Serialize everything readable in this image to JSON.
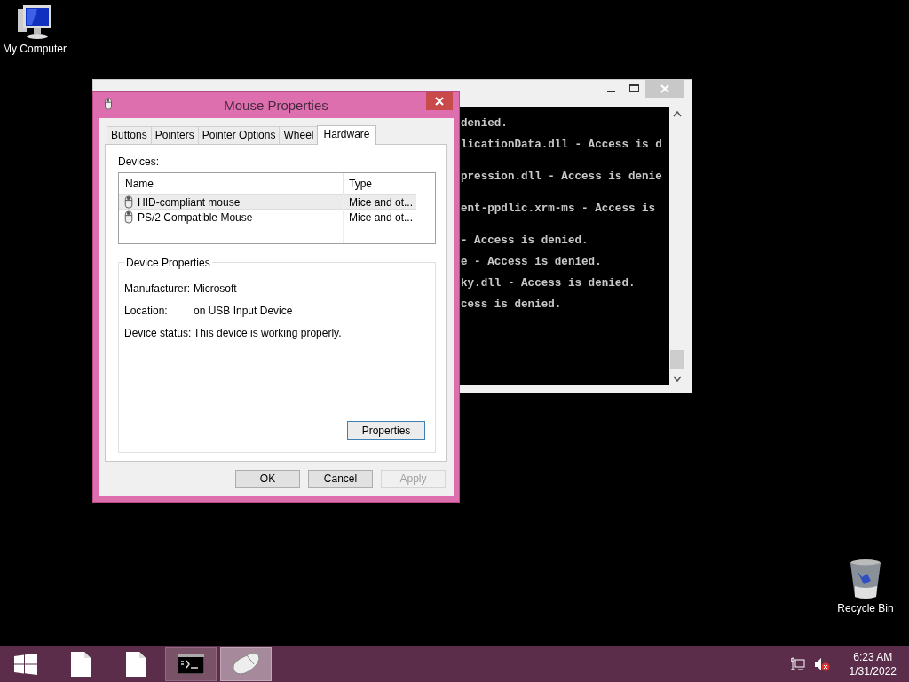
{
  "desktop_icons": [
    {
      "label": "My Computer",
      "kind": "computer"
    },
    {
      "label": "Recycle Bin",
      "kind": "bin"
    }
  ],
  "console_window": {
    "lines": [
      "denied.",
      "licationData.dll - Access is d",
      "pression.dll - Access is denie",
      "ent-ppdlic.xrm-ms - Access is",
      "- Access is denied.",
      "e - Access is denied.",
      "ky.dll - Access is denied.",
      "cess is denied."
    ]
  },
  "dialog": {
    "title": "Mouse Properties",
    "tabs": [
      {
        "label": "Buttons",
        "selected": false
      },
      {
        "label": "Pointers",
        "selected": false
      },
      {
        "label": "Pointer Options",
        "selected": false
      },
      {
        "label": "Wheel",
        "selected": false
      },
      {
        "label": "Hardware",
        "selected": true
      }
    ],
    "devices_label": "Devices:",
    "columns": [
      "Name",
      "Type"
    ],
    "devices": [
      {
        "name": "HID-compliant mouse",
        "type": "Mice and ot...",
        "selected": true
      },
      {
        "name": "PS/2 Compatible Mouse",
        "type": "Mice and ot...",
        "selected": false
      }
    ],
    "group_title": "Device Properties",
    "properties": [
      {
        "label": "Manufacturer:",
        "value": "Microsoft"
      },
      {
        "label": "Location:",
        "value": "on USB Input Device"
      },
      {
        "label": "Device status:",
        "value": "This device is working properly."
      }
    ],
    "properties_button": "Properties",
    "buttons": [
      {
        "label": "OK",
        "disabled": false
      },
      {
        "label": "Cancel",
        "disabled": false
      },
      {
        "label": "Apply",
        "disabled": true
      }
    ]
  },
  "taskbar": {
    "items": [
      {
        "kind": "start",
        "open": false,
        "selected": false
      },
      {
        "kind": "file",
        "open": false,
        "selected": false
      },
      {
        "kind": "file",
        "open": false,
        "selected": false
      },
      {
        "kind": "console",
        "open": true,
        "selected": false
      },
      {
        "kind": "mouse",
        "open": true,
        "selected": true
      }
    ],
    "time": "6:23 AM",
    "date": "1/31/2022"
  }
}
